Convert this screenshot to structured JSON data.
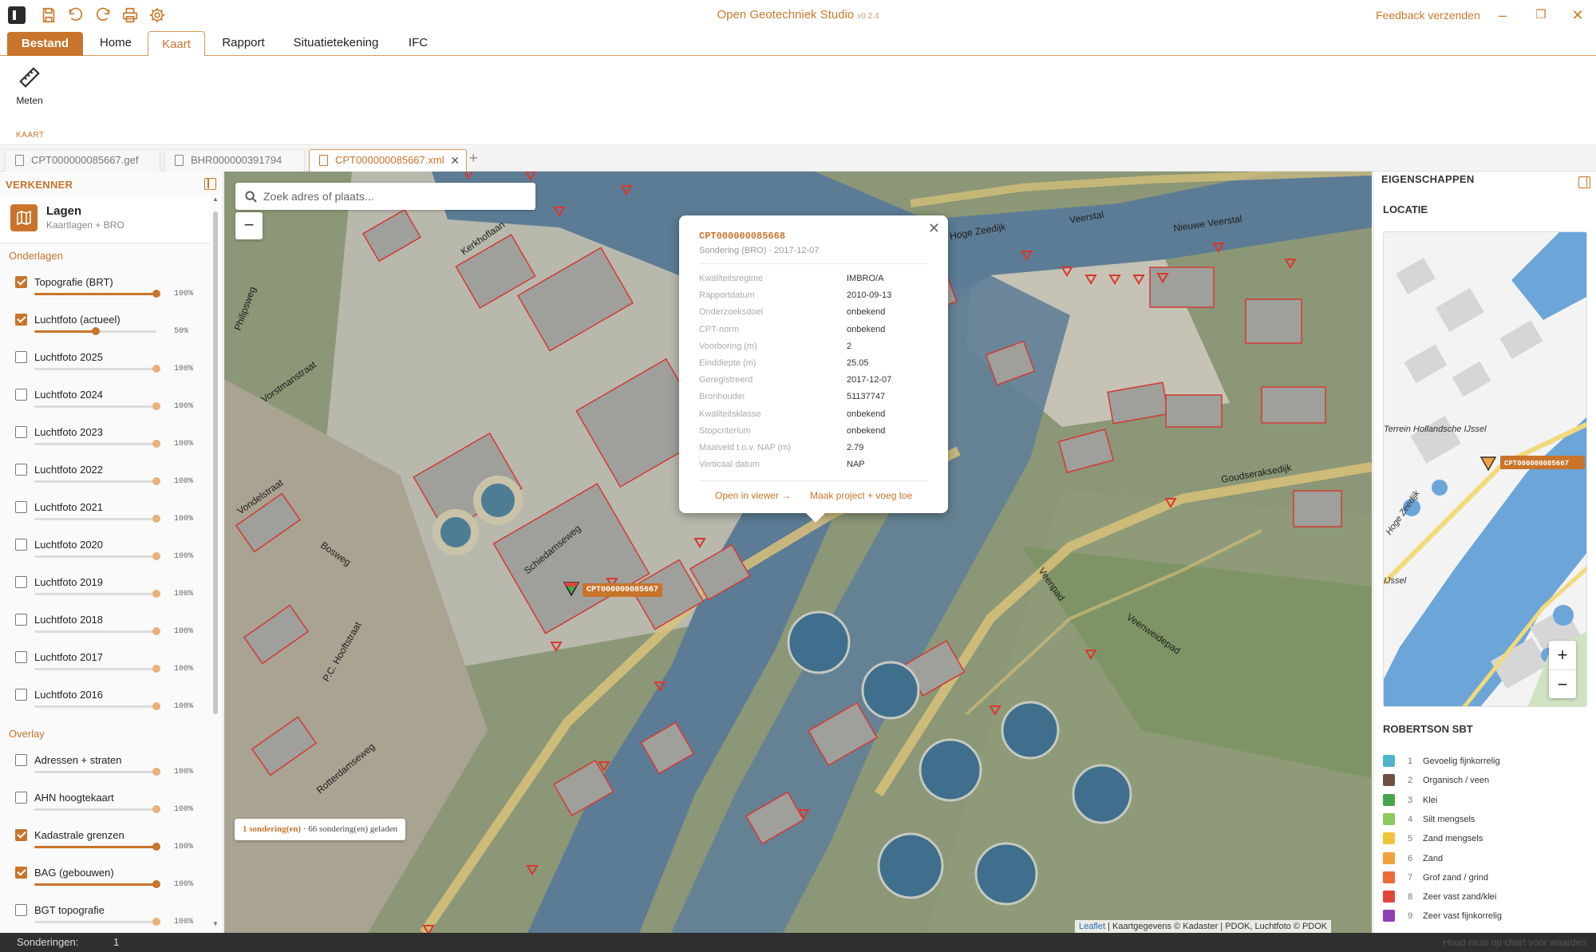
{
  "app": {
    "title": "Open Geotechniek Studio",
    "version": "v0.2.4",
    "feedback": "Feedback verzenden"
  },
  "ribbon": {
    "tabs": [
      {
        "label": "Bestand"
      },
      {
        "label": "Home"
      },
      {
        "label": "Kaart"
      },
      {
        "label": "Rapport"
      },
      {
        "label": "Situatietekening"
      },
      {
        "label": "IFC"
      }
    ],
    "measure_label": "Meten",
    "group_label": "KAART"
  },
  "doc_tabs": [
    {
      "label": "CPT000000085667.gef"
    },
    {
      "label": "BHR000000391794"
    },
    {
      "label": "CPT000000085667.xml"
    }
  ],
  "explorer": {
    "title": "VERKENNER",
    "layers_title": "Lagen",
    "layers_sub": "Kaartlagen + BRO",
    "base_title": "Onderlagen",
    "base_layers": [
      {
        "name": "Topografie (BRT)",
        "checked": true,
        "opacity": 100,
        "pct": "100%"
      },
      {
        "name": "Luchtfoto (actueel)",
        "checked": true,
        "opacity": 50,
        "pct": "50%"
      },
      {
        "name": "Luchtfoto 2025",
        "checked": false,
        "opacity": 100,
        "pct": "100%"
      },
      {
        "name": "Luchtfoto 2024",
        "checked": false,
        "opacity": 100,
        "pct": "100%"
      },
      {
        "name": "Luchtfoto 2023",
        "checked": false,
        "opacity": 100,
        "pct": "100%"
      },
      {
        "name": "Luchtfoto 2022",
        "checked": false,
        "opacity": 100,
        "pct": "100%"
      },
      {
        "name": "Luchtfoto 2021",
        "checked": false,
        "opacity": 100,
        "pct": "100%"
      },
      {
        "name": "Luchtfoto 2020",
        "checked": false,
        "opacity": 100,
        "pct": "100%"
      },
      {
        "name": "Luchtfoto 2019",
        "checked": false,
        "opacity": 100,
        "pct": "100%"
      },
      {
        "name": "Luchtfoto 2018",
        "checked": false,
        "opacity": 100,
        "pct": "100%"
      },
      {
        "name": "Luchtfoto 2017",
        "checked": false,
        "opacity": 100,
        "pct": "100%"
      },
      {
        "name": "Luchtfoto 2016",
        "checked": false,
        "opacity": 100,
        "pct": "100%"
      }
    ],
    "overlay_title": "Overlay",
    "overlay_layers": [
      {
        "name": "Adressen + straten",
        "checked": false,
        "opacity": 100,
        "pct": "100%"
      },
      {
        "name": "AHN hoogtekaart",
        "checked": false,
        "opacity": 100,
        "pct": "100%"
      },
      {
        "name": "Kadastrale grenzen",
        "checked": true,
        "opacity": 100,
        "pct": "100%"
      },
      {
        "name": "BAG (gebouwen)",
        "checked": true,
        "opacity": 100,
        "pct": "100%"
      },
      {
        "name": "BGT topografie",
        "checked": false,
        "opacity": 100,
        "pct": "100%"
      }
    ]
  },
  "map": {
    "search_placeholder": "Zoek adres of plaats...",
    "zoom_out": "−",
    "popup": {
      "title": "CPT000000085668",
      "subtitle": "Sondering (BRO) · 2017-12-07",
      "rows": [
        {
          "k": "Kwaliteitsregime",
          "v": "IMBRO/A"
        },
        {
          "k": "Rapportdatum",
          "v": "2010-09-13"
        },
        {
          "k": "Onderzoeksdoel",
          "v": "onbekend"
        },
        {
          "k": "CPT-norm",
          "v": "onbekend"
        },
        {
          "k": "Voorboring (m)",
          "v": "2"
        },
        {
          "k": "Einddiepte (m)",
          "v": "25.05"
        },
        {
          "k": "Geregistreerd",
          "v": "2017-12-07"
        },
        {
          "k": "Bronhouder",
          "v": "51137747"
        },
        {
          "k": "Kwaliteitsklasse",
          "v": "onbekend"
        },
        {
          "k": "Stopcriterium",
          "v": "onbekend"
        },
        {
          "k": "Maaiveld t.o.v. NAP (m)",
          "v": "2.79"
        },
        {
          "k": "Verticaal datum",
          "v": "NAP"
        }
      ],
      "open_action": "Open in viewer →",
      "make_action": "Maak project + voeg toe"
    },
    "marker_label": "CPT000000085667",
    "street_labels": [
      "Kerkhoflaan",
      "Vorstmanstraat",
      "Philipsweg",
      "Vondelstraat",
      "Bosweg",
      "P.C. Hooftstraat",
      "Rotterdamseweg",
      "Schiedamseweg",
      "Hoge Zeedijk",
      "Veerstal",
      "Nieuwe Veerstal",
      "Goudseraksedijk",
      "Veenweidepad",
      "Veenpad"
    ],
    "status_highlight": "1 sondering(en)",
    "status_rest": " · 66 sondering(en) geladen",
    "attribution_leaflet": "Leaflet",
    "attribution_rest": " | Kaartgegevens © Kadaster | PDOK, Luchtfoto © PDOK"
  },
  "properties": {
    "title": "EIGENSCHAPPEN",
    "location_title": "LOCATIE",
    "minimap_labels": [
      "Terrein Hollandsche IJssel",
      "Hoge Zeedijk",
      "IJssel"
    ],
    "minimap_marker": "CPT000000085667",
    "zoom_in": "+",
    "zoom_out": "−",
    "robertson_title": "ROBERTSON SBT",
    "robertson": [
      {
        "num": "1",
        "name": "Gevoelig fijnkorrelig",
        "color": "#4fb3d0"
      },
      {
        "num": "2",
        "name": "Organisch / veen",
        "color": "#6e5145"
      },
      {
        "num": "3",
        "name": "Klei",
        "color": "#49a34a"
      },
      {
        "num": "4",
        "name": "Silt mengsels",
        "color": "#8dc85c"
      },
      {
        "num": "5",
        "name": "Zand mengsels",
        "color": "#f0c43a"
      },
      {
        "num": "6",
        "name": "Zand",
        "color": "#f2a23c"
      },
      {
        "num": "7",
        "name": "Grof zand / grind",
        "color": "#ee6a3a"
      },
      {
        "num": "8",
        "name": "Zeer vast zand/klei",
        "color": "#e2453c"
      },
      {
        "num": "9",
        "name": "Zeer vast fijnkorrelig",
        "color": "#8e3fb5"
      }
    ]
  },
  "statusbar": {
    "label": "Sonderingen:",
    "count": "1",
    "hint": "Houd muis op chart voor waarden"
  }
}
